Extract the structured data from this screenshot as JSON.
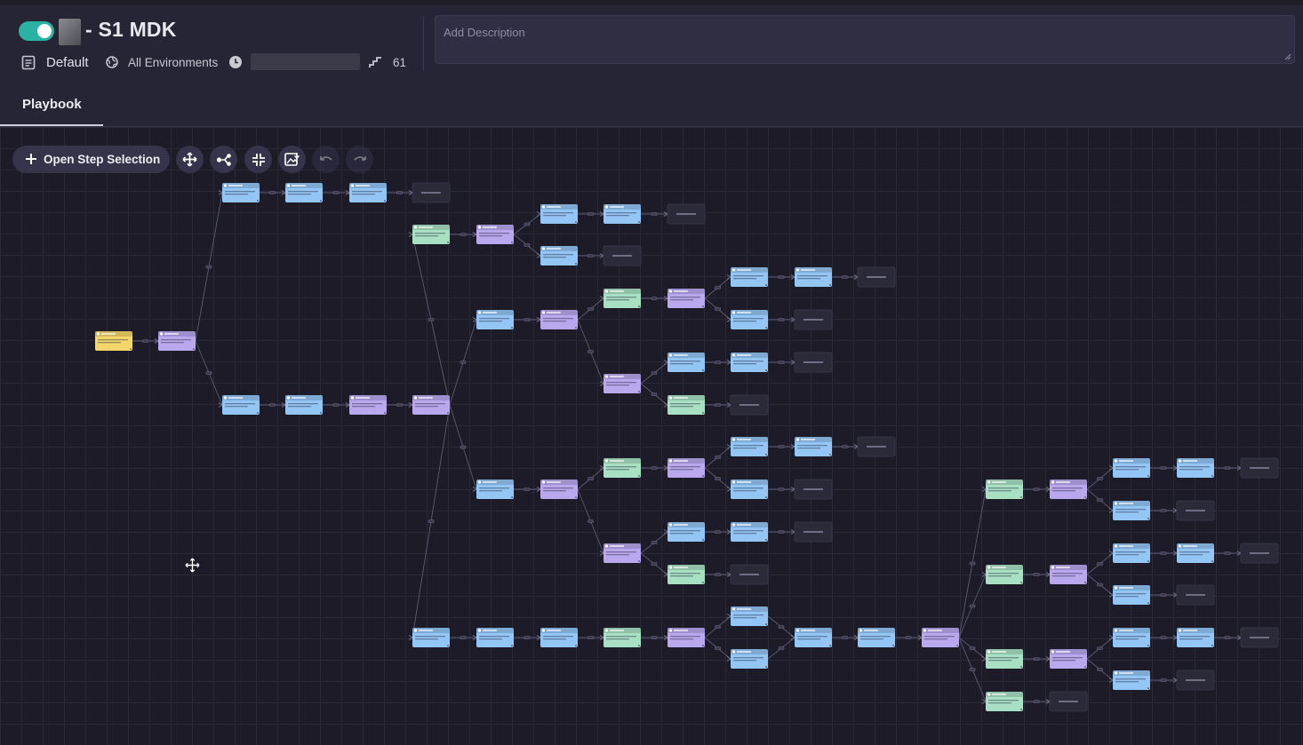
{
  "header": {
    "title": "- S1 MDK",
    "enabled": true,
    "folder_label": "Default",
    "environment_label": "All Environments",
    "step_count": "61",
    "description_placeholder": "Add Description"
  },
  "tabs": [
    {
      "label": "Playbook",
      "active": true
    }
  ],
  "toolbar": {
    "open_step_selection_label": "Open Step Selection",
    "tools": [
      "move-icon",
      "auto-arrange-icon",
      "fit-view-icon",
      "export-image-icon",
      "undo-icon",
      "redo-icon"
    ]
  },
  "node_colors": {
    "trigger": "#f5d66b",
    "action": "#93c5f5",
    "condition": "#b9a8ee",
    "utility": "#a8e0c4",
    "end": "#2a2a38"
  },
  "flow": {
    "nodes": [
      {
        "id": "trig",
        "type": "trigger"
      },
      {
        "id": "c0",
        "type": "condition"
      },
      {
        "id": "a1",
        "type": "action"
      },
      {
        "id": "a2",
        "type": "action"
      },
      {
        "id": "a3",
        "type": "action"
      },
      {
        "id": "e1",
        "type": "end"
      },
      {
        "id": "b1",
        "type": "action"
      },
      {
        "id": "b2",
        "type": "action"
      },
      {
        "id": "b3",
        "type": "condition"
      },
      {
        "id": "b4",
        "type": "condition"
      },
      {
        "id": "u1",
        "type": "utility"
      },
      {
        "id": "p1",
        "type": "condition"
      },
      {
        "id": "a4",
        "type": "action"
      },
      {
        "id": "a5",
        "type": "action"
      },
      {
        "id": "e2",
        "type": "end"
      },
      {
        "id": "a6",
        "type": "action"
      },
      {
        "id": "e3",
        "type": "end"
      },
      {
        "id": "d1",
        "type": "action"
      },
      {
        "id": "d2",
        "type": "condition"
      },
      {
        "id": "u2",
        "type": "utility"
      },
      {
        "id": "p2",
        "type": "condition"
      },
      {
        "id": "a7",
        "type": "action"
      },
      {
        "id": "a8",
        "type": "action"
      },
      {
        "id": "e4",
        "type": "end"
      },
      {
        "id": "a9",
        "type": "action"
      },
      {
        "id": "e5",
        "type": "end"
      },
      {
        "id": "p3",
        "type": "condition"
      },
      {
        "id": "a10",
        "type": "action"
      },
      {
        "id": "a11",
        "type": "action"
      },
      {
        "id": "e6",
        "type": "end"
      },
      {
        "id": "u3",
        "type": "utility"
      },
      {
        "id": "e7",
        "type": "end"
      },
      {
        "id": "f1",
        "type": "action"
      },
      {
        "id": "f2",
        "type": "condition"
      },
      {
        "id": "u4",
        "type": "utility"
      },
      {
        "id": "p4",
        "type": "condition"
      },
      {
        "id": "a12",
        "type": "action"
      },
      {
        "id": "a13",
        "type": "action"
      },
      {
        "id": "e8",
        "type": "end"
      },
      {
        "id": "a14",
        "type": "action"
      },
      {
        "id": "e9",
        "type": "end"
      },
      {
        "id": "p5",
        "type": "condition"
      },
      {
        "id": "a15",
        "type": "action"
      },
      {
        "id": "a16",
        "type": "action"
      },
      {
        "id": "e10",
        "type": "end"
      },
      {
        "id": "u5",
        "type": "utility"
      },
      {
        "id": "e11",
        "type": "end"
      },
      {
        "id": "g1",
        "type": "action"
      },
      {
        "id": "g2",
        "type": "action"
      },
      {
        "id": "g3",
        "type": "action"
      },
      {
        "id": "g4",
        "type": "utility"
      },
      {
        "id": "g5",
        "type": "condition"
      },
      {
        "id": "g6",
        "type": "action"
      },
      {
        "id": "g7",
        "type": "action"
      },
      {
        "id": "g8",
        "type": "action"
      },
      {
        "id": "g9",
        "type": "action"
      },
      {
        "id": "g10",
        "type": "condition"
      },
      {
        "id": "h1",
        "type": "utility"
      },
      {
        "id": "h2",
        "type": "condition"
      },
      {
        "id": "h3",
        "type": "action"
      },
      {
        "id": "h4",
        "type": "action"
      },
      {
        "id": "e12",
        "type": "end"
      },
      {
        "id": "h5",
        "type": "action"
      },
      {
        "id": "e13",
        "type": "end"
      },
      {
        "id": "i1",
        "type": "utility"
      },
      {
        "id": "i2",
        "type": "condition"
      },
      {
        "id": "i3",
        "type": "action"
      },
      {
        "id": "i4",
        "type": "action"
      },
      {
        "id": "e14",
        "type": "end"
      },
      {
        "id": "i5",
        "type": "action"
      },
      {
        "id": "e15",
        "type": "end"
      },
      {
        "id": "j1",
        "type": "utility"
      },
      {
        "id": "j2",
        "type": "condition"
      },
      {
        "id": "j3",
        "type": "action"
      },
      {
        "id": "j4",
        "type": "action"
      },
      {
        "id": "e16",
        "type": "end"
      },
      {
        "id": "j5",
        "type": "action"
      },
      {
        "id": "e17",
        "type": "end"
      },
      {
        "id": "k1",
        "type": "utility"
      },
      {
        "id": "e18",
        "type": "end"
      }
    ],
    "edges": [
      [
        "trig",
        "c0"
      ],
      [
        "c0",
        "a1"
      ],
      [
        "c0",
        "b1"
      ],
      [
        "a1",
        "a2"
      ],
      [
        "a2",
        "a3"
      ],
      [
        "a3",
        "e1"
      ],
      [
        "b1",
        "b2"
      ],
      [
        "b2",
        "b3"
      ],
      [
        "b3",
        "b4"
      ],
      [
        "b4",
        "u1"
      ],
      [
        "b4",
        "d1"
      ],
      [
        "b4",
        "f1"
      ],
      [
        "b4",
        "g1"
      ],
      [
        "u1",
        "p1"
      ],
      [
        "p1",
        "a4"
      ],
      [
        "p1",
        "a6"
      ],
      [
        "a4",
        "a5"
      ],
      [
        "a5",
        "e2"
      ],
      [
        "a6",
        "e3"
      ],
      [
        "d1",
        "d2"
      ],
      [
        "d2",
        "u2"
      ],
      [
        "d2",
        "p3"
      ],
      [
        "u2",
        "p2"
      ],
      [
        "p2",
        "a7"
      ],
      [
        "p2",
        "a9"
      ],
      [
        "a7",
        "a8"
      ],
      [
        "a8",
        "e4"
      ],
      [
        "a9",
        "e5"
      ],
      [
        "p3",
        "a10"
      ],
      [
        "p3",
        "u3"
      ],
      [
        "a10",
        "a11"
      ],
      [
        "a11",
        "e6"
      ],
      [
        "u3",
        "e7"
      ],
      [
        "f1",
        "f2"
      ],
      [
        "f2",
        "u4"
      ],
      [
        "f2",
        "p5"
      ],
      [
        "u4",
        "p4"
      ],
      [
        "p4",
        "a12"
      ],
      [
        "p4",
        "a14"
      ],
      [
        "a12",
        "a13"
      ],
      [
        "a13",
        "e8"
      ],
      [
        "a14",
        "e9"
      ],
      [
        "p5",
        "a15"
      ],
      [
        "p5",
        "u5"
      ],
      [
        "a15",
        "a16"
      ],
      [
        "a16",
        "e10"
      ],
      [
        "u5",
        "e11"
      ],
      [
        "g1",
        "g2"
      ],
      [
        "g2",
        "g3"
      ],
      [
        "g3",
        "g4"
      ],
      [
        "g4",
        "g5"
      ],
      [
        "g5",
        "g6"
      ],
      [
        "g5",
        "g7"
      ],
      [
        "g6",
        "g8"
      ],
      [
        "g7",
        "g8"
      ],
      [
        "g8",
        "g9"
      ],
      [
        "g9",
        "g10"
      ],
      [
        "g10",
        "h1"
      ],
      [
        "g10",
        "i1"
      ],
      [
        "g10",
        "j1"
      ],
      [
        "g10",
        "k1"
      ],
      [
        "h1",
        "h2"
      ],
      [
        "h2",
        "h3"
      ],
      [
        "h2",
        "h5"
      ],
      [
        "h3",
        "h4"
      ],
      [
        "h4",
        "e12"
      ],
      [
        "h5",
        "e13"
      ],
      [
        "i1",
        "i2"
      ],
      [
        "i2",
        "i3"
      ],
      [
        "i2",
        "i5"
      ],
      [
        "i3",
        "i4"
      ],
      [
        "i4",
        "e14"
      ],
      [
        "i5",
        "e15"
      ],
      [
        "j1",
        "j2"
      ],
      [
        "j2",
        "j3"
      ],
      [
        "j2",
        "j5"
      ],
      [
        "j3",
        "j4"
      ],
      [
        "j4",
        "e16"
      ],
      [
        "j5",
        "e17"
      ],
      [
        "k1",
        "e18"
      ]
    ]
  }
}
